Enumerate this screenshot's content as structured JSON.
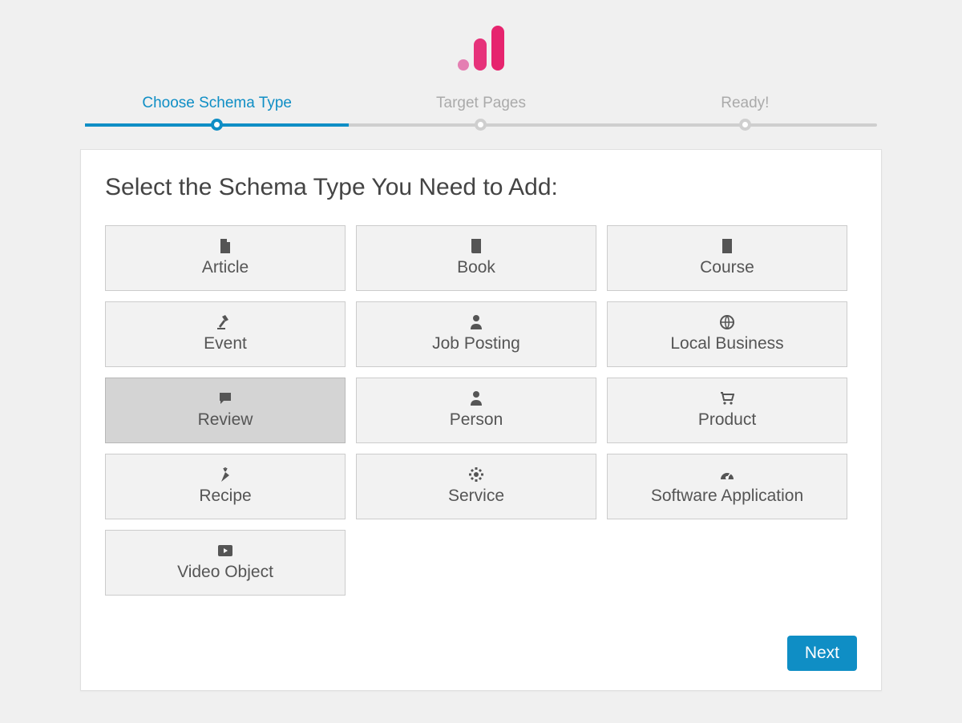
{
  "stepper": {
    "steps": [
      {
        "label": "Choose Schema Type",
        "active": true
      },
      {
        "label": "Target Pages",
        "active": false
      },
      {
        "label": "Ready!",
        "active": false
      }
    ]
  },
  "heading": "Select the Schema Type You Need to Add:",
  "schemas": [
    {
      "label": "Article",
      "icon": "file-icon",
      "selected": false
    },
    {
      "label": "Book",
      "icon": "book-icon",
      "selected": false
    },
    {
      "label": "Course",
      "icon": "doc-icon",
      "selected": false
    },
    {
      "label": "Event",
      "icon": "gavel-icon",
      "selected": false
    },
    {
      "label": "Job Posting",
      "icon": "person-icon",
      "selected": false
    },
    {
      "label": "Local Business",
      "icon": "globe-icon",
      "selected": false
    },
    {
      "label": "Review",
      "icon": "comment-icon",
      "selected": true
    },
    {
      "label": "Person",
      "icon": "person-icon",
      "selected": false
    },
    {
      "label": "Product",
      "icon": "cart-icon",
      "selected": false
    },
    {
      "label": "Recipe",
      "icon": "carrot-icon",
      "selected": false
    },
    {
      "label": "Service",
      "icon": "gear-icon",
      "selected": false
    },
    {
      "label": "Software Application",
      "icon": "gauge-icon",
      "selected": false
    },
    {
      "label": "Video Object",
      "icon": "play-icon",
      "selected": false
    }
  ],
  "next_label": "Next",
  "colors": {
    "accent": "#0f8ec5",
    "brand_pink": "#e6327a"
  }
}
